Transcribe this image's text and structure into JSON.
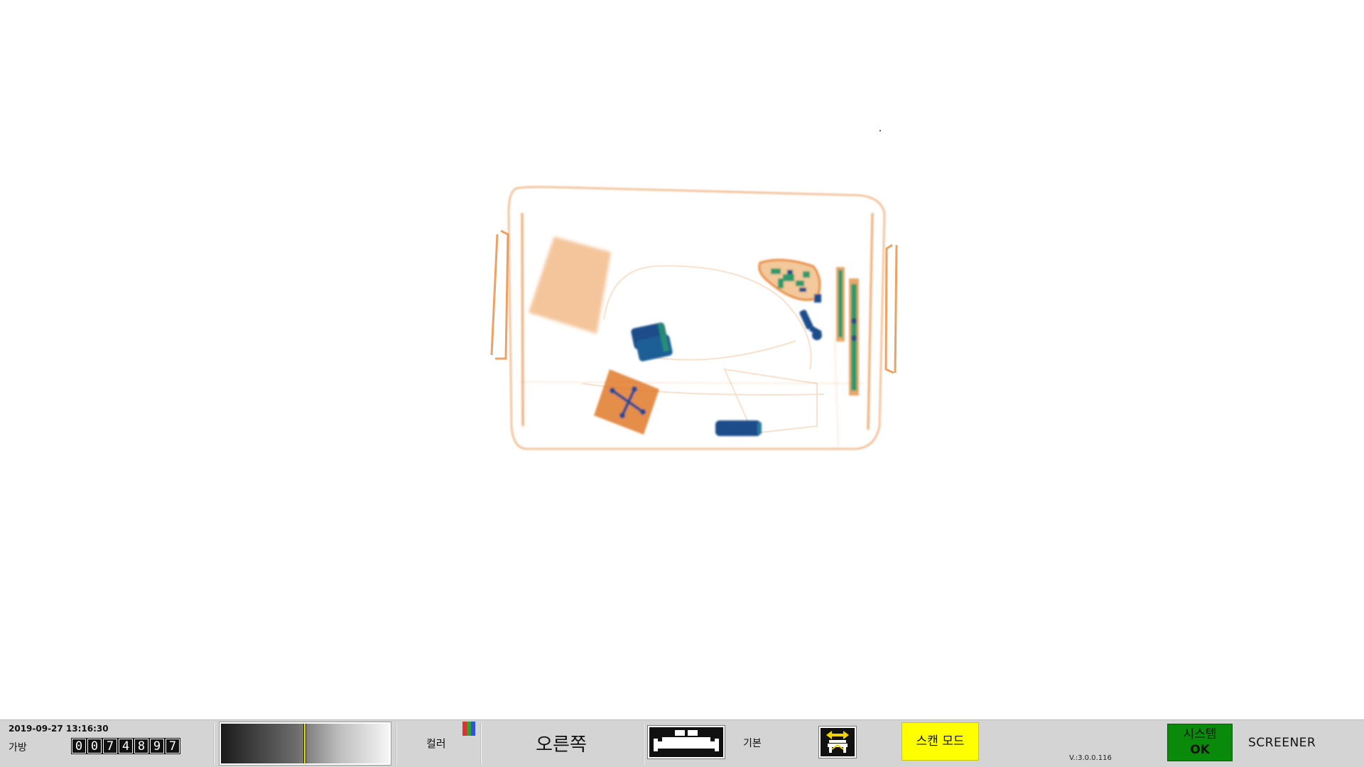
{
  "status_bar": {
    "datetime": "2019-09-27 13:16:30",
    "bag_label": "가방",
    "bag_count_digits": [
      "0",
      "0",
      "7",
      "4",
      "8",
      "9",
      "7"
    ],
    "gray_level_fraction": 0.49,
    "color_label": "컬러",
    "color_icon_colors": [
      "#e03030",
      "#30a030",
      "#3050e0"
    ],
    "direction_label": "오른쪽",
    "belt_icon": "conveyor-belt-icon",
    "mode_label": "기본",
    "function_icon": "scanner-function-icon",
    "scan_mode_label": "스캔 모드",
    "scan_mode_color": "#ffff00",
    "version": "V.:3.0.0.116",
    "system_label": "시스템",
    "system_state": "OK",
    "system_state_color": "#0a8a0a",
    "role_label": "SCREENER"
  },
  "xray_image": {
    "description_icon": "xray-baggage-image",
    "palette": {
      "organic": "#e98a3c",
      "inorganic": "#2a9a6a",
      "metal": "#1f4d8a"
    }
  }
}
